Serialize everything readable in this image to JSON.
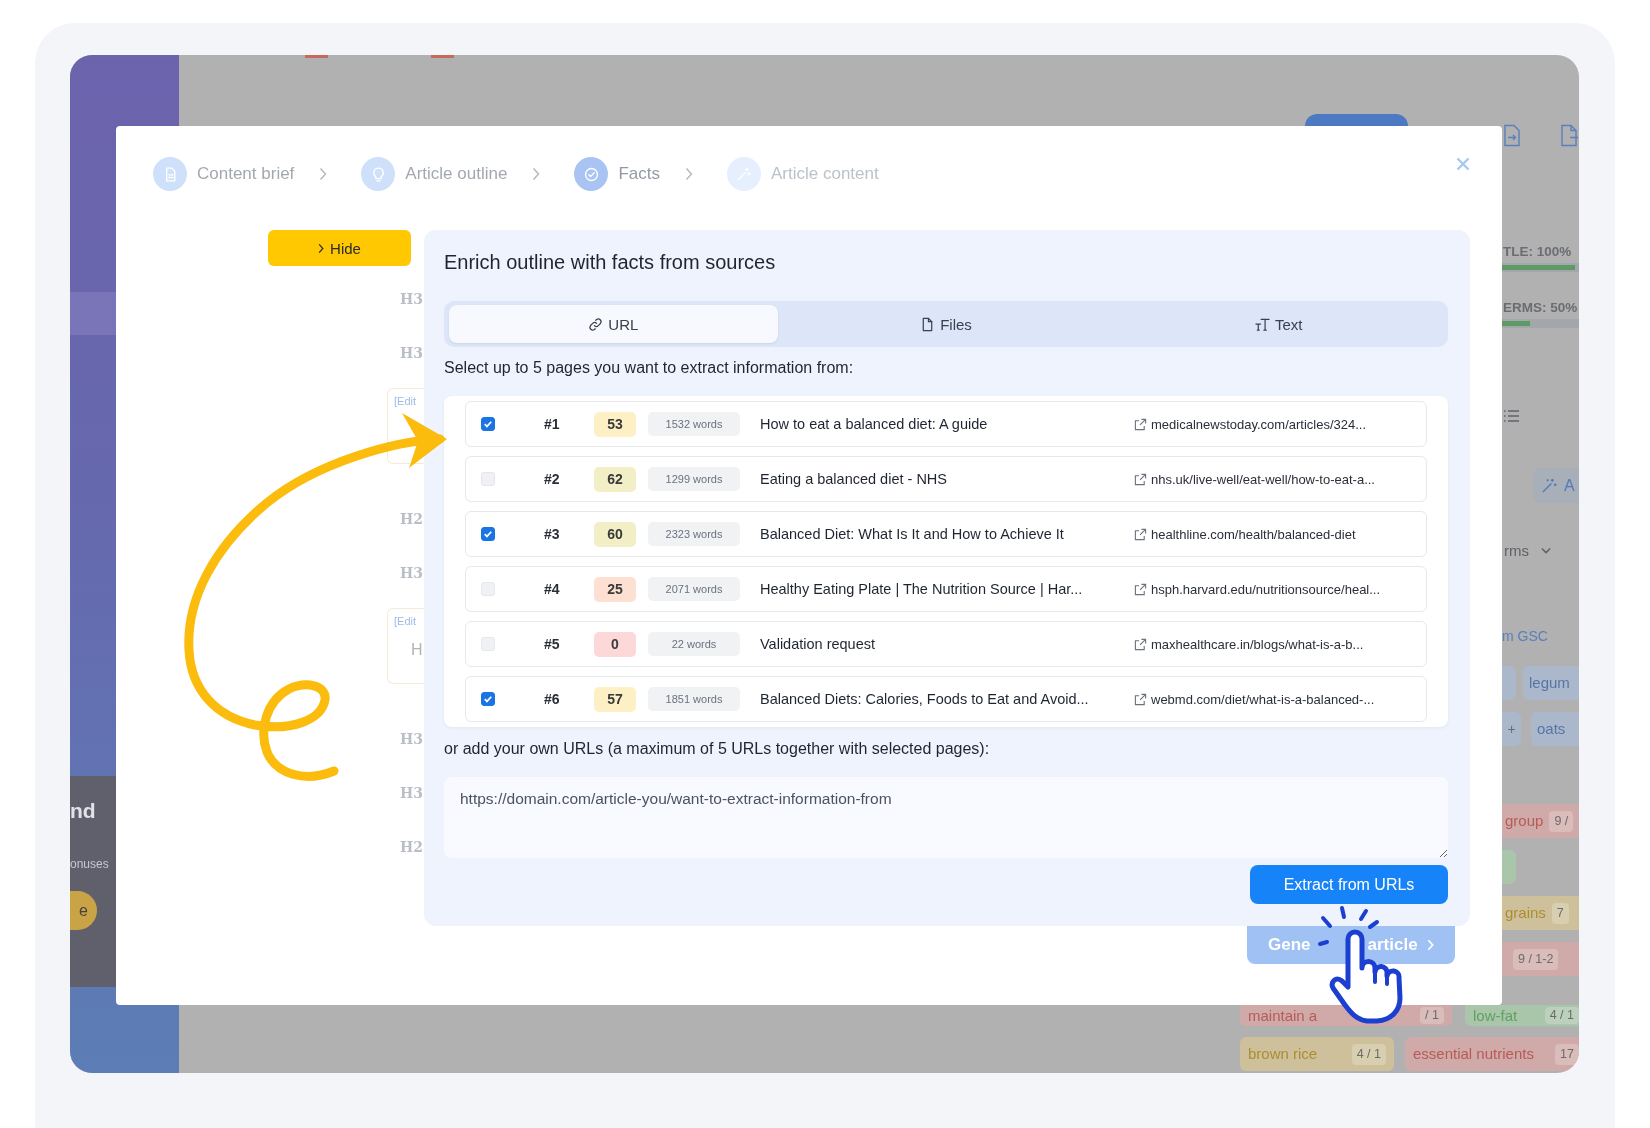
{
  "app_background": {
    "sidebar": {
      "card_title": "nd",
      "card_text": "onuses",
      "button_label": "e"
    },
    "right_panel": {
      "meters": [
        {
          "label": "TLE: 100%",
          "level": 1
        },
        {
          "label": "ERMS: 50%",
          "level": 0.38
        }
      ],
      "magic_button": {
        "label": "A"
      },
      "dropdown": {
        "label": "rms"
      },
      "source_label": "m GSC",
      "tag_rows": [
        {
          "items": [
            {
              "kind": "fragment",
              "color": "#abb8cc"
            },
            {
              "kind": "tag",
              "text": "legum",
              "color": "#abb8cc"
            }
          ]
        },
        {
          "items": [
            {
              "kind": "plus",
              "text": "+",
              "color": "#abb8cc"
            },
            {
              "kind": "tag",
              "text": "oats",
              "color": "#abb8cc"
            }
          ]
        },
        {
          "items": [
            {
              "kind": "tag",
              "text": "group",
              "count": "9 /",
              "color": "#d0aaa8"
            }
          ]
        },
        {
          "items": [
            {
              "kind": "fragment",
              "color": "#a9c5aa"
            }
          ]
        },
        {
          "items": [
            {
              "kind": "tag",
              "text": "grains",
              "count": "7",
              "color": "#cdc09a"
            }
          ]
        },
        {
          "items": [
            {
              "kind": "tag",
              "count": "9 / 1-2",
              "color": "#d0aaa8"
            }
          ]
        }
      ]
    },
    "bottom_tag_rows": [
      {
        "items": [
          {
            "kind": "tag",
            "text": "maintain a",
            "count": "/ 1",
            "color": "#d0aaa8"
          },
          {
            "kind": "tag",
            "text": "low-fat",
            "count": "4 / 1",
            "color": "#a9c5aa"
          }
        ]
      },
      {
        "items": [
          {
            "kind": "tag",
            "text": "brown rice",
            "count": "4 / 1",
            "color": "#cdc09a"
          },
          {
            "kind": "tag",
            "text": "essential nutrients",
            "count": "17",
            "color": "#d0aaa8"
          }
        ]
      }
    ]
  },
  "modal": {
    "steps": [
      {
        "label": "Content brief",
        "selected": false,
        "disabled": false
      },
      {
        "label": "Article outline",
        "selected": false,
        "disabled": false
      },
      {
        "label": "Facts",
        "selected": true,
        "disabled": false
      },
      {
        "label": "Article content",
        "selected": false,
        "disabled": true
      }
    ],
    "hide_button": {
      "label": "Hide"
    },
    "outline": [
      {
        "kind": "heading",
        "text": "H3"
      },
      {
        "kind": "heading",
        "text": "H3"
      },
      {
        "kind": "note",
        "text": "[Edit"
      },
      {
        "kind": "heading",
        "text": "H2"
      },
      {
        "kind": "heading",
        "text": "H3"
      },
      {
        "kind": "note",
        "text": "[Edit",
        "line": "H"
      },
      {
        "kind": "heading",
        "text": "H3"
      },
      {
        "kind": "heading",
        "text": "H3"
      },
      {
        "kind": "heading",
        "text": "H2"
      }
    ],
    "panel": {
      "title": "Enrich outline with facts from sources",
      "tabs": [
        {
          "label": "URL",
          "selected": true
        },
        {
          "label": "Files",
          "selected": false
        },
        {
          "label": "Text",
          "selected": false
        }
      ],
      "instruction": "Select up to 5 pages you want to extract information from:",
      "results": [
        {
          "checked": true,
          "rank": "#1",
          "score": "53",
          "color": "#fdf0c5",
          "words": "1532 words",
          "title": "How to eat a balanced diet: A guide",
          "url": "medicalnewstoday.com/articles/324..."
        },
        {
          "checked": false,
          "rank": "#2",
          "score": "62",
          "color": "#f2efc6",
          "words": "1299 words",
          "title": "Eating a balanced diet - NHS",
          "url": "nhs.uk/live-well/eat-well/how-to-eat-a..."
        },
        {
          "checked": true,
          "rank": "#3",
          "score": "60",
          "color": "#f2efc6",
          "words": "2323 words",
          "title": "Balanced Diet: What Is It and How to Achieve It",
          "url": "healthline.com/health/balanced-diet"
        },
        {
          "checked": false,
          "rank": "#4",
          "score": "25",
          "color": "#fde0d2",
          "words": "2071 words",
          "title": "Healthy Eating Plate | The Nutrition Source | Har...",
          "url": "hsph.harvard.edu/nutritionsource/heal..."
        },
        {
          "checked": false,
          "rank": "#5",
          "score": "0",
          "color": "#fdd8d8",
          "words": "22 words",
          "title": "Validation request",
          "url": "maxhealthcare.in/blogs/what-is-a-b..."
        },
        {
          "checked": true,
          "rank": "#6",
          "score": "57",
          "color": "#fdf0c5",
          "words": "1851 words",
          "title": "Balanced Diets: Calories, Foods to Eat and Avoid...",
          "url": "webmd.com/diet/what-is-a-balanced-..."
        }
      ],
      "custom_urls_label": "or add your own URLs (a maximum of 5 URLs together with selected pages):",
      "url_field": {
        "placeholder": "https://domain.com/article-you/want-to-extract-information-from"
      },
      "extract_button": {
        "label": "Extract from URLs"
      }
    },
    "generate_button": {
      "label_start": "Gene",
      "label_end": "article"
    }
  }
}
